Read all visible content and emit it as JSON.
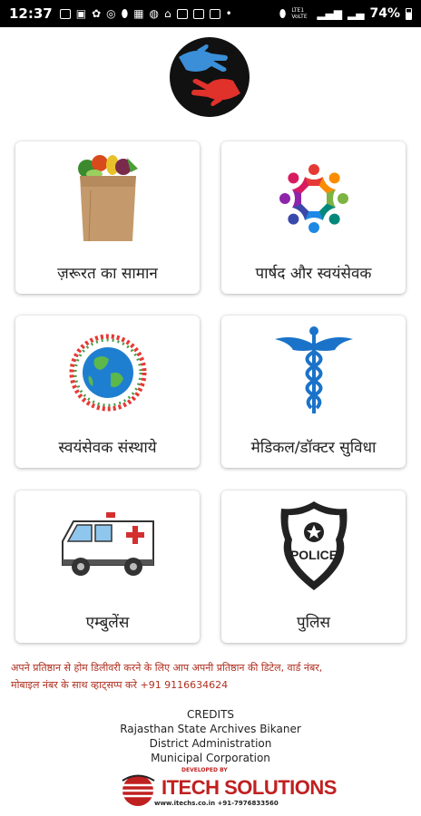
{
  "status_bar": {
    "time": "12:37",
    "battery": "74%",
    "network": "LTE1 VoLTE"
  },
  "cards": [
    {
      "label": "ज़रूरत का सामान",
      "icon": "grocery-bag-icon"
    },
    {
      "label": "पार्षद और स्वयंसेवक",
      "icon": "people-circle-icon"
    },
    {
      "label": "स्वयंसेवक संस्थाये",
      "icon": "globe-people-icon"
    },
    {
      "label": "मेडिकल/डॉक्टर सुविधा",
      "icon": "caduceus-icon"
    },
    {
      "label": "एम्बुलेंस",
      "icon": "ambulance-icon"
    },
    {
      "label": "पुलिस",
      "icon": "police-badge-icon"
    }
  ],
  "badge_text": "POLICE",
  "notice": {
    "line1": "अपने प्रतिष्ठान से होम डिलीवरी करने के लिए आप अपनी प्रतिष्ठान की डिटेल, वार्ड नंबर,",
    "line2": "मोबाइल नंबर के साथ व्हाट्सप्प करे +91 9116634624"
  },
  "credits": {
    "title": "CREDITS",
    "line1": "Rajasthan State Archives Bikaner",
    "line2": "District Administration",
    "line3": "Municipal Corporation",
    "developed_by": "DEVELOPED BY",
    "company": "ITECH SOLUTIONS",
    "contact": "www.itechs.co.in +91-7976833560"
  },
  "colors": {
    "notice_red": "#b03020",
    "brand_red": "#c02020",
    "caduceus_blue": "#1a73c9"
  }
}
